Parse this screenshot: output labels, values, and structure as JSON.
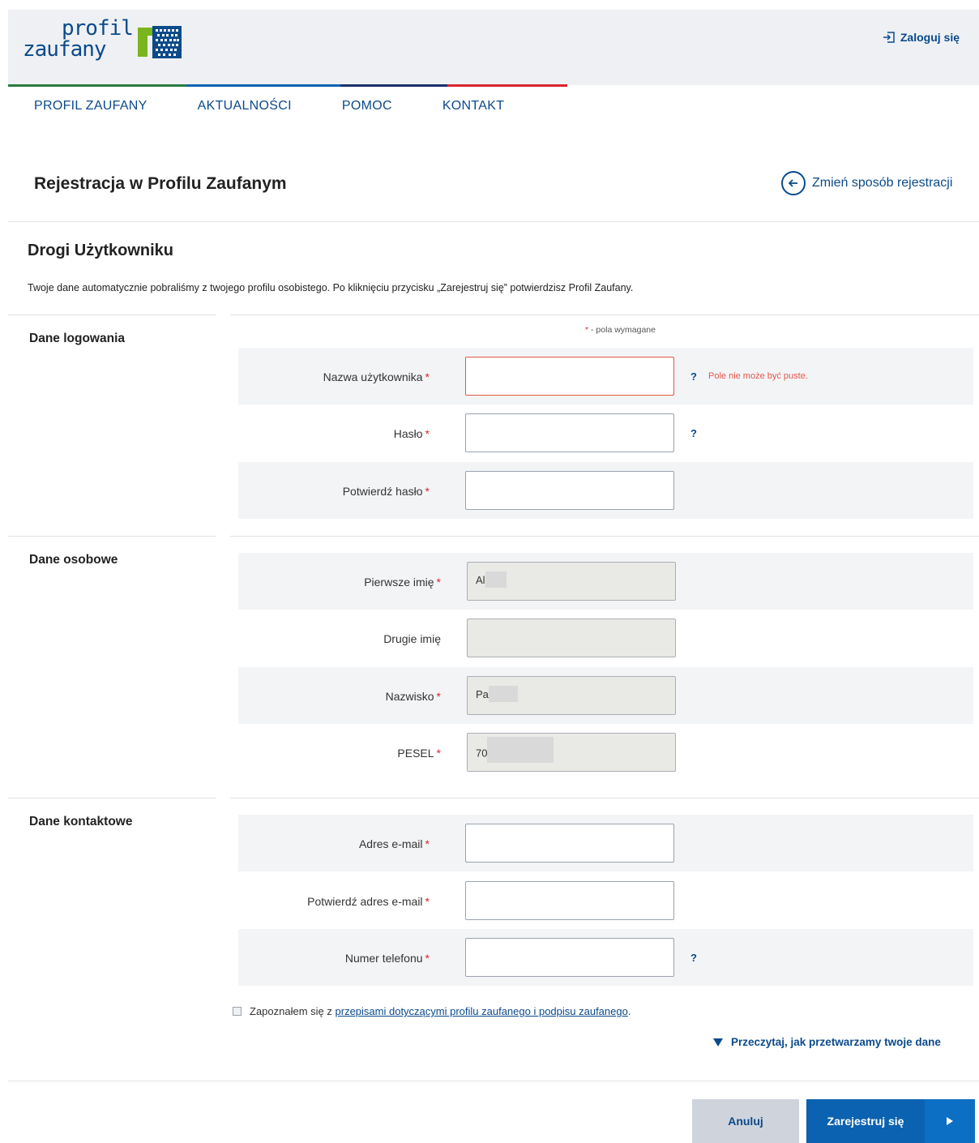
{
  "header": {
    "logo_line1": "profil",
    "logo_line2": "zaufany",
    "login_label": "Zaloguj się",
    "colors": {
      "blue": "#0b4a8b",
      "green": "#7ab51d",
      "red": "#d9262c"
    }
  },
  "nav": {
    "items": [
      {
        "label": "PROFIL ZAUFANY"
      },
      {
        "label": "AKTUALNOŚCI"
      },
      {
        "label": "POMOC"
      },
      {
        "label": "KONTAKT"
      }
    ]
  },
  "page": {
    "title": "Rejestracja w Profilu Zaufanym",
    "change_way": "Zmień sposób rejestracji",
    "greeting": "Drogi Użytkowniku",
    "intro": "Twoje dane automatycznie pobraliśmy z twojego profilu osobistego. Po kliknięciu przycisku „Zarejestruj się” potwierdzisz Profil Zaufany.",
    "required_note": "- pola wymagane",
    "required_star": "*"
  },
  "sections": {
    "login": {
      "title": "Dane logowania",
      "username": {
        "label": "Nazwa użytkownika",
        "value": "",
        "error": "Pole nie może być puste."
      },
      "password": {
        "label": "Hasło",
        "value": ""
      },
      "password_confirm": {
        "label": "Potwierdź hasło",
        "value": ""
      }
    },
    "personal": {
      "title": "Dane osobowe",
      "first_name": {
        "label": "Pierwsze imię",
        "value": "Ala"
      },
      "middle_name": {
        "label": "Drugie imię",
        "value": ""
      },
      "last_name": {
        "label": "Nazwisko",
        "value": "Pa"
      },
      "pesel": {
        "label": "PESEL",
        "value": "70"
      }
    },
    "contact": {
      "title": "Dane kontaktowe",
      "email": {
        "label": "Adres e-mail",
        "value": ""
      },
      "email_confirm": {
        "label": "Potwierdź adres e-mail",
        "value": ""
      },
      "phone": {
        "label": "Numer telefonu",
        "value": ""
      }
    }
  },
  "help_mark": "?",
  "agreement": {
    "prefix": "Zapoznałem się z",
    "link": "przepisami dotyczącymi profilu zaufanego i podpisu zaufanego",
    "suffix": ".",
    "checked": false
  },
  "read_link": "Przeczytaj, jak przetwarzamy twoje dane",
  "buttons": {
    "cancel": "Anuluj",
    "submit": "Zarejestruj się"
  }
}
